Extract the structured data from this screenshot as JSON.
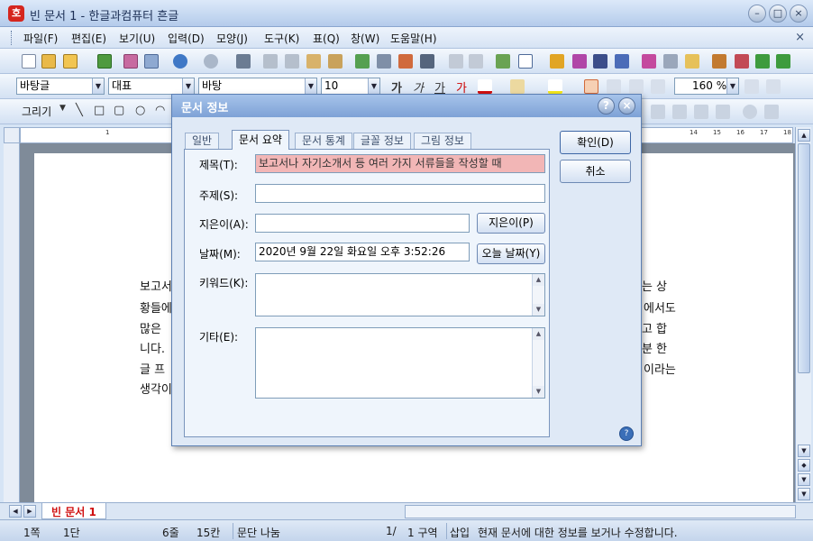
{
  "window": {
    "app_icon": "호",
    "title": "빈 문서 1 - 한글과컴퓨터 흔글",
    "min": "–",
    "max": "□",
    "close": "×"
  },
  "menu": {
    "items": [
      "파일(F)",
      "편집(E)",
      "보기(U)",
      "입력(D)",
      "모양(J)",
      "도구(K)",
      "표(Q)",
      "창(W)",
      "도움말(H)"
    ],
    "close": "×"
  },
  "format_toolbar": {
    "style": "바탕글",
    "language": "대표",
    "font": "바탕",
    "size": "10",
    "zoom": "160 %",
    "bold": "가",
    "italic": "가",
    "underline": "가",
    "strike": "가"
  },
  "draw_toolbar": {
    "label": "그리기"
  },
  "ruler_numbers": [
    "1",
    "2",
    "14",
    "15",
    "16",
    "17",
    "18"
  ],
  "document": {
    "lines_left": [
      "보고서",
      "황들에",
      "많은",
      "니다.",
      "글  프",
      "생각이"
    ],
    "lines_right": [
      "하는  상",
      "에서도",
      "하고  합",
      "부분  한",
      "이라는"
    ]
  },
  "tabbar": {
    "doc_tab": "빈 문서 1"
  },
  "status": {
    "page": "1쪽",
    "column": "1단",
    "line": "6줄",
    "col": "15칸",
    "break": "문단 나눔",
    "total": "1/",
    "section": "1 구역",
    "mode": "삽입",
    "message": "현재 문서에 대한 정보를 보거나 수정합니다."
  },
  "dialog": {
    "title": "문서 정보",
    "help_btn": "?",
    "close_btn": "×",
    "tabs": [
      "일반",
      "문서 요약",
      "문서 통계",
      "글꼴 정보",
      "그림 정보"
    ],
    "active_tab": 1,
    "fields": {
      "title_label": "제목(T):",
      "title_value": "보고서나 자기소개서 등 여러 가지 서류들을 작성할 때",
      "subject_label": "주제(S):",
      "subject_value": "",
      "author_label": "지은이(A):",
      "author_value": "",
      "author_btn": "지은이(P)",
      "date_label": "날짜(M):",
      "date_value": "2020년 9월 22일 화요일 오후 3:52:26",
      "today_btn": "오늘 날짜(Y)",
      "keyword_label": "키워드(K):",
      "keyword_value": "",
      "other_label": "기타(E):",
      "other_value": ""
    },
    "ok_btn": "확인(D)",
    "cancel_btn": "취소",
    "corner_help": "?"
  }
}
